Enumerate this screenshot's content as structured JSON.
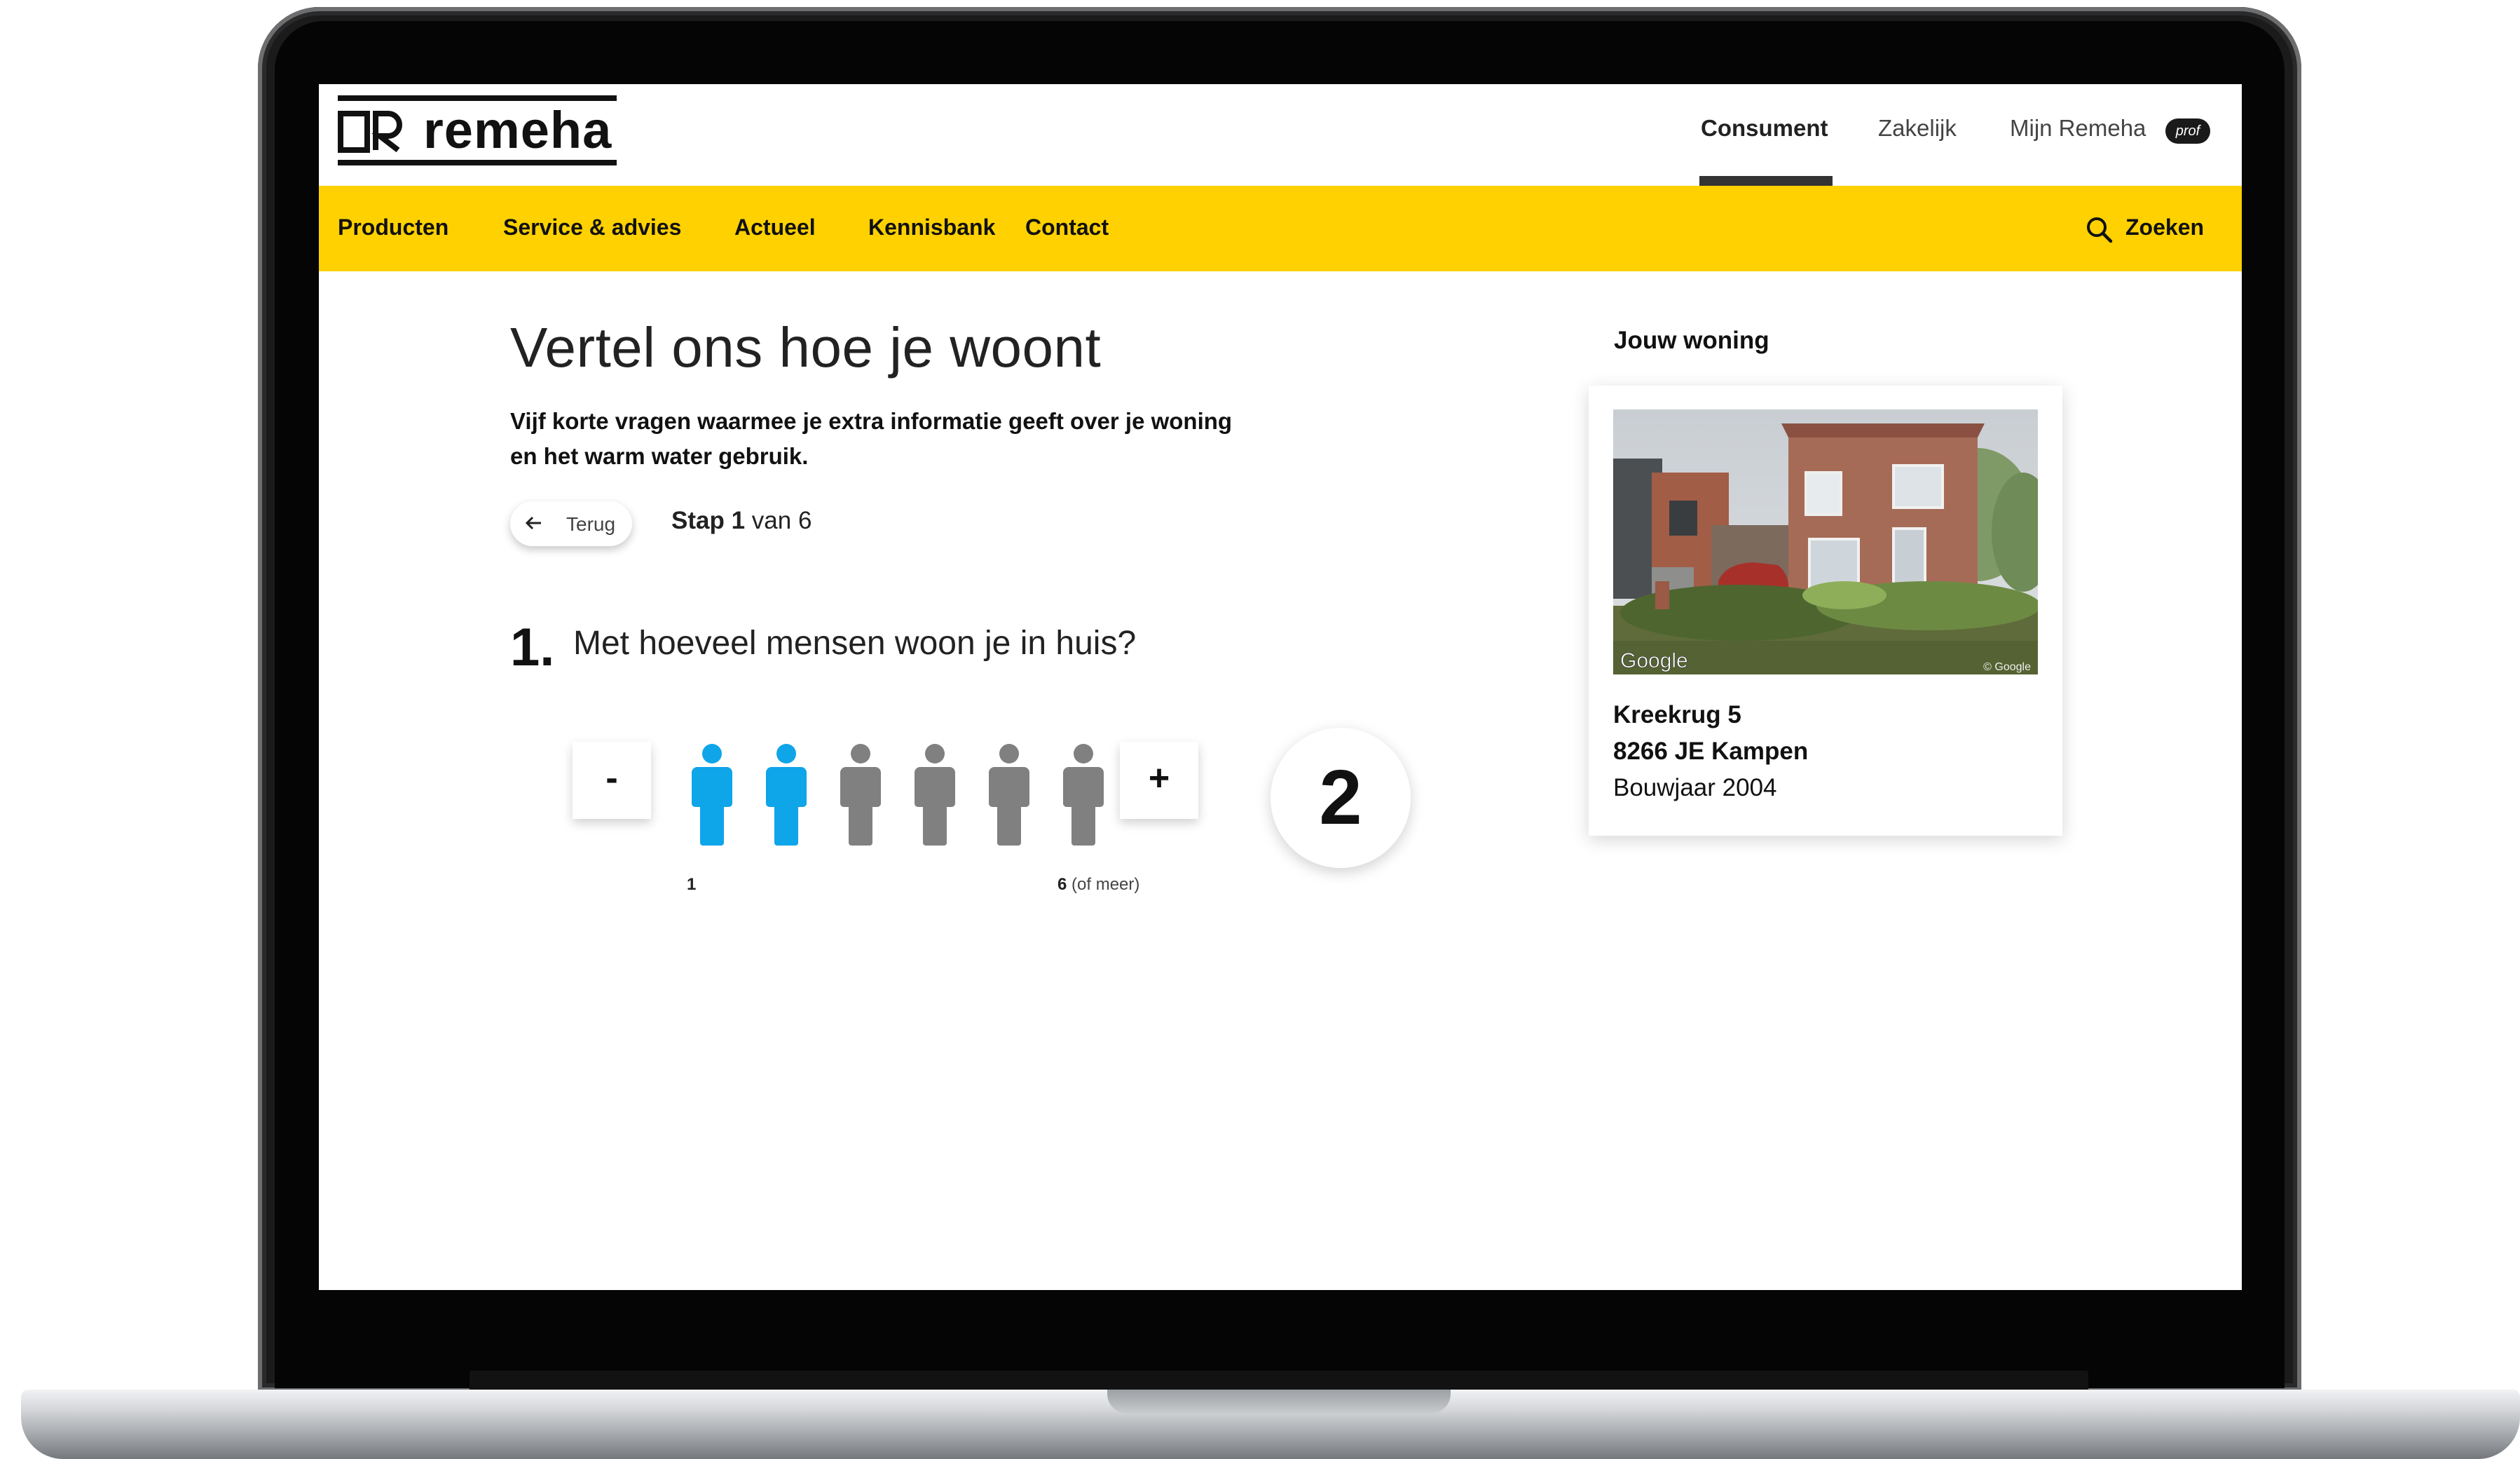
{
  "brand": {
    "name": "remeha",
    "accent": "#ffd100"
  },
  "header": {
    "top_nav": [
      "Consument",
      "Zakelijk",
      "Mijn Remeha"
    ],
    "active_top_nav": "Consument",
    "prof_badge": "prof"
  },
  "main_nav": {
    "items": [
      "Producten",
      "Service & advies",
      "Actueel",
      "Kennisbank",
      "Contact"
    ],
    "search_label": "Zoeken",
    "search_icon": "search-icon"
  },
  "page": {
    "title": "Vertel ons hoe je woont",
    "intro": "Vijf korte vragen waarmee je extra informatie geeft over je woning en het warm water gebruik.",
    "back_label": "Terug",
    "step_label": "Stap",
    "step_current": "1",
    "step_total_text": "van 6"
  },
  "question": {
    "number": "1.",
    "text": "Met hoeveel mensen woon je in huis?",
    "minus_label": "-",
    "plus_label": "+",
    "value": "2",
    "selected": 2,
    "max": 6,
    "scale_min": "1",
    "scale_max_num": "6",
    "scale_max_suffix": "(of meer)",
    "active_color": "#0ea5e9",
    "inactive_color": "#808080"
  },
  "house_card": {
    "title": "Jouw woning",
    "photo_watermark": "Google",
    "photo_copyright": "© Google",
    "street": "Kreekrug 5",
    "city": "8266 JE Kampen",
    "build_year": "Bouwjaar 2004"
  }
}
